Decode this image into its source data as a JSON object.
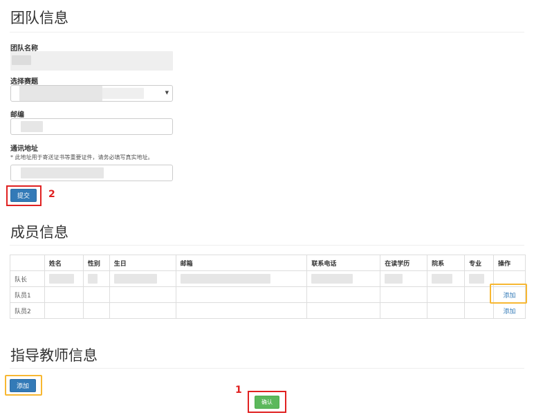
{
  "team": {
    "title": "团队信息",
    "name_label": "团队名称",
    "competition_label": "选择赛题",
    "postcode_label": "邮编",
    "address_label": "通讯地址",
    "address_hint": "* 此地址用于寄送证书等重要证件，请务必填写真实地址。",
    "submit_label": "提交",
    "annotation_number": "2"
  },
  "members": {
    "title": "成员信息",
    "headers": [
      "",
      "姓名",
      "性别",
      "生日",
      "邮箱",
      "联系电话",
      "在读学历",
      "院系",
      "专业",
      "操作"
    ],
    "rows": [
      {
        "role": "队长",
        "action": ""
      },
      {
        "role": "队员1",
        "action": "添加"
      },
      {
        "role": "队员2",
        "action": "添加"
      }
    ]
  },
  "advisor": {
    "title": "指导教师信息",
    "add_label": "添加"
  },
  "confirm": {
    "label": "确认",
    "annotation_number": "1"
  },
  "colors": {
    "primary": "#337ab7",
    "success": "#5cb85c",
    "annotation_red": "#e02020",
    "annotation_yellow": "#f7b731"
  }
}
